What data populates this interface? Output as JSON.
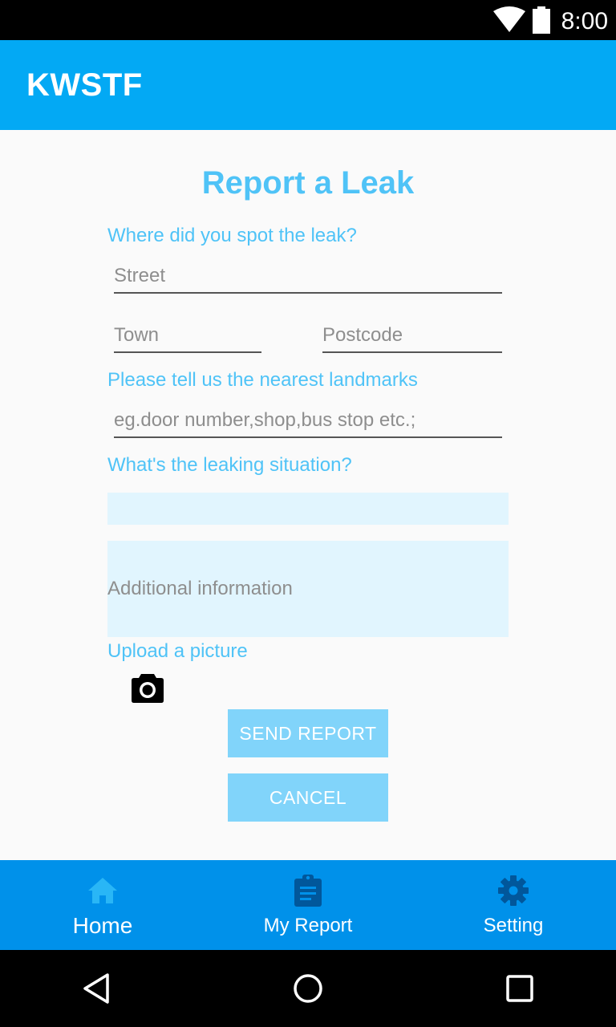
{
  "status_bar": {
    "time": "8:00",
    "wifi_icon": "wifi-icon",
    "battery_icon": "battery-icon"
  },
  "app_bar": {
    "title": "KWSTF"
  },
  "form": {
    "title": "Report a Leak",
    "location_label": "Where did you spot the leak?",
    "street_placeholder": "Street",
    "town_placeholder": "Town",
    "postcode_placeholder": "Postcode",
    "landmarks_label": "Please tell us the nearest landmarks",
    "landmarks_placeholder": "eg.door number,shop,bus stop etc.;",
    "situation_label": "What's the leaking situation?",
    "situation_value": "",
    "additional_placeholder": "Additional information",
    "upload_label": "Upload a picture",
    "camera_icon": "camera-icon",
    "send_label": "SEND REPORT",
    "cancel_label": "CANCEL"
  },
  "bottom_nav": {
    "items": [
      {
        "label": "Home",
        "icon": "home-icon",
        "active": true
      },
      {
        "label": "My Report",
        "icon": "clipboard-icon",
        "active": false
      },
      {
        "label": "Setting",
        "icon": "gear-icon",
        "active": false
      }
    ]
  },
  "system_nav": {
    "back_icon": "back-icon",
    "home_icon": "circle-home-icon",
    "recents_icon": "recents-icon"
  },
  "colors": {
    "app_bar": "#03a9f4",
    "accent_text": "#4fc3f7",
    "input_bg": "#e1f5fe",
    "button_bg": "#81d4fa",
    "bottom_nav": "#0091ea",
    "home_icon_active": "#29b6f6",
    "nav_icon_dark": "#01579b"
  }
}
